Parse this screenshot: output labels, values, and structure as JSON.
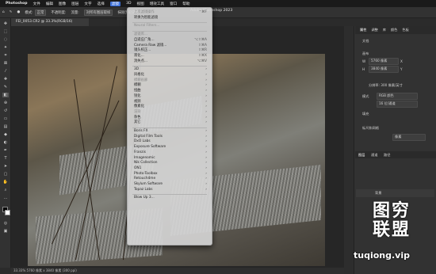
{
  "menubar": {
    "app": "Photoshop",
    "items": [
      "文件",
      "编辑",
      "图像",
      "图层",
      "文字",
      "选择",
      "滤镜",
      "3D",
      "视图",
      "增效工具",
      "窗口",
      "帮助"
    ],
    "active_index": 6
  },
  "window_title": "Adobe Photoshop 2023",
  "options_bar": {
    "mode_label": "模式:",
    "mode_value": "正常",
    "opacity_label": "不透明度:",
    "flow_label": "流量:",
    "sample_label": "对所有图层取样",
    "erase_history": "抹除历史记录"
  },
  "document_tab": "FEI_0053.CR2 @ 33.3%(RGB/16)",
  "status_bar": "33.33%   5760 像素 x 3840 像素 (300 ppi)",
  "filter_menu": {
    "items": [
      {
        "label": "上次滤镜操作",
        "shortcut": "⌃⌘F",
        "disabled": true
      },
      {
        "label": "转换为智能滤镜",
        "disabled": false
      },
      {
        "sep": true
      },
      {
        "label": "Neural Filters...",
        "disabled": true
      },
      {
        "sep": true
      },
      {
        "label": "滤镜库...",
        "disabled": true
      },
      {
        "label": "自适应广角...",
        "shortcut": "⌥⇧⌘A",
        "disabled": false
      },
      {
        "label": "Camera Raw 滤镜...",
        "shortcut": "⇧⌘A",
        "disabled": false
      },
      {
        "label": "镜头校正...",
        "shortcut": "⇧⌘R",
        "disabled": false
      },
      {
        "label": "液化...",
        "shortcut": "⇧⌘X",
        "disabled": false
      },
      {
        "label": "消失点...",
        "shortcut": "⌥⌘V",
        "disabled": false
      },
      {
        "sep": true
      },
      {
        "label": "3D",
        "submenu": true,
        "disabled": false
      },
      {
        "label": "风格化",
        "submenu": true,
        "disabled": false
      },
      {
        "label": "模糊画廊",
        "submenu": true,
        "disabled": true
      },
      {
        "label": "模糊",
        "submenu": true,
        "disabled": false
      },
      {
        "label": "扭曲",
        "submenu": true,
        "disabled": false
      },
      {
        "label": "锐化",
        "submenu": true,
        "disabled": false
      },
      {
        "label": "视频",
        "submenu": true,
        "disabled": false
      },
      {
        "label": "像素化",
        "submenu": true,
        "disabled": false
      },
      {
        "label": "渲染",
        "submenu": true,
        "disabled": true
      },
      {
        "label": "杂色",
        "submenu": true,
        "disabled": false
      },
      {
        "label": "其它",
        "submenu": true,
        "disabled": false
      },
      {
        "sep": true
      },
      {
        "label": "Boris FX",
        "submenu": true,
        "disabled": false
      },
      {
        "label": "Digital Film Tools",
        "submenu": true,
        "disabled": false
      },
      {
        "label": "DxO Labs",
        "submenu": true,
        "disabled": false
      },
      {
        "label": "Exposure Software",
        "submenu": true,
        "disabled": false
      },
      {
        "label": "Franzis",
        "submenu": true,
        "disabled": false
      },
      {
        "label": "Imagenomic",
        "submenu": true,
        "disabled": false
      },
      {
        "label": "Nik Collection",
        "submenu": true,
        "disabled": false
      },
      {
        "label": "ON1",
        "submenu": true,
        "disabled": false
      },
      {
        "label": "Photo-Toolbox",
        "submenu": true,
        "disabled": false
      },
      {
        "label": "Retouch4me",
        "submenu": true,
        "disabled": false
      },
      {
        "label": "Skylum Software",
        "submenu": true,
        "disabled": false
      },
      {
        "label": "Topaz Labs",
        "submenu": true,
        "disabled": false
      },
      {
        "sep": true
      },
      {
        "label": "Blow Up 3...",
        "disabled": false
      }
    ]
  },
  "right_panel": {
    "tabs": [
      "属性",
      "调整",
      "库",
      "颜色",
      "色板"
    ],
    "doc_label": "文档",
    "canvas_label": "画布",
    "w_label": "W",
    "w_value": "5760 像素",
    "h_label": "H",
    "h_value": "3840 像素",
    "x_label": "X",
    "y_label": "Y",
    "resolution": "分辨率: 300 像素/英寸",
    "mode_label": "模式",
    "mode_value": "RGB 颜色",
    "depth_value": "16 位/通道",
    "fill_label": "填充",
    "ruler_label": "标尺和网格",
    "units_value": "像素",
    "layers_tabs": [
      "图层",
      "通道",
      "路径"
    ],
    "layer_name": "背景"
  },
  "watermark": {
    "line1": "图穷",
    "line2": "联盟",
    "url": "tuqiong.vip"
  },
  "colors": {
    "menu_highlight": "#3d6fd6",
    "dropdown_bg": "#d6d6d6"
  }
}
